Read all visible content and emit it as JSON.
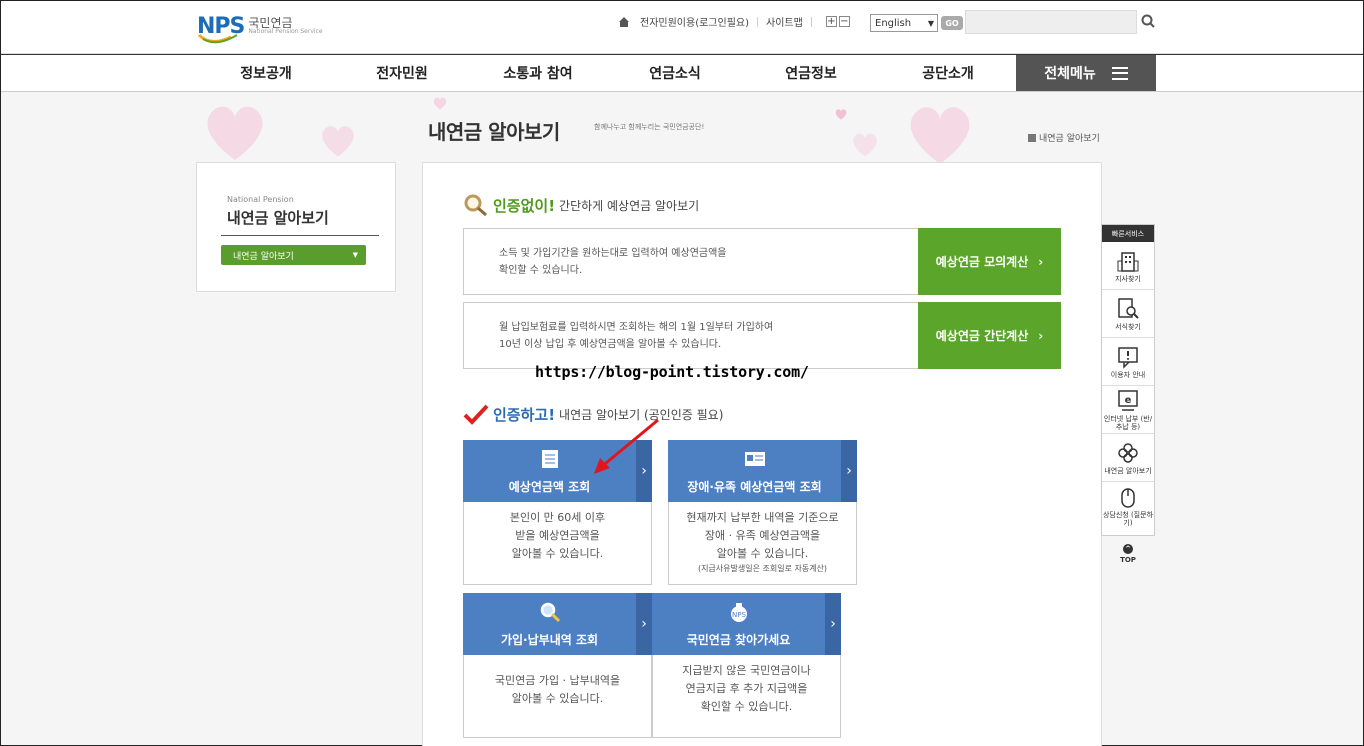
{
  "header": {
    "logo_text": "NPS",
    "logo_kr": "국민연금",
    "logo_en": "National Pension Service",
    "util_links": [
      "전자민원이용(로그인필요)",
      "사이트맵"
    ],
    "zoom_in": "+",
    "zoom_out": "−",
    "language": "English",
    "go_label": "GO",
    "search_placeholder": ""
  },
  "gnb": {
    "items": [
      "정보공개",
      "전자민원",
      "소통과 참여",
      "연금소식",
      "연금정보",
      "공단소개"
    ],
    "all_menu": "전체메뉴"
  },
  "page": {
    "title": "내연금 알아보기",
    "subtitle": "함께나누고 함께누리는 국민연금공단!",
    "breadcrumb": "내연금 알아보기"
  },
  "lnb": {
    "en": "National Pension",
    "title": "내연금 알아보기",
    "button": "내연금 알아보기"
  },
  "section1": {
    "strong": "인증없이!",
    "rest": "간단하게 예상연금 알아보기",
    "boxes": [
      {
        "line1": "소득 및 가입기간을 원하는대로 입력하여 예상연금액을",
        "line2": "확인할 수 있습니다.",
        "button": "예상연금 모의계산"
      },
      {
        "line1": "월 납입보험료를 입력하시면 조회하는 해의 1월 1일부터 가입하여",
        "line2": "10년 이상 납입 후 예상연금액을 알아볼 수 있습니다.",
        "button": "예상연금 간단계산"
      }
    ]
  },
  "watermark": "https://blog-point.tistory.com/",
  "section2": {
    "strong": "인증하고!",
    "rest": "내연금 알아보기 (공인인증 필요)",
    "cards": [
      {
        "title": "예상연금액 조회",
        "l1": "본인이 만 60세 이후",
        "l2": "받을 예상연금액을",
        "l3": "알아볼 수 있습니다.",
        "note": ""
      },
      {
        "title": "장애·유족 예상연금액 조회",
        "l1": "현재까지 납부한 내역을 기준으로",
        "l2": "장애 · 유족 예상연금액을",
        "l3": "알아볼 수 있습니다.",
        "note": "(지급사유발생일은 조회일로 자동계산)"
      },
      {
        "title": "가입·납부내역 조회",
        "l1": "국민연금 가입 · 납부내역을",
        "l2": "알아볼 수 있습니다.",
        "l3": "",
        "note": ""
      },
      {
        "title": "국민연금 찾아가세요",
        "l1": "지급받지 않은 국민연금이나",
        "l2": "연금지급 후 추가 지급액을",
        "l3": "확인할 수 있습니다.",
        "note": ""
      }
    ]
  },
  "quick": {
    "title": "빠른서비스",
    "items": [
      "지사찾기",
      "서식찾기",
      "이용자 안내",
      "인터넷 납부 (반/추납 등)",
      "내연금 알아보기",
      "상담신청 (질문하기)"
    ],
    "top": "TOP"
  },
  "colors": {
    "green": "#5aa52a",
    "blue": "#4d7fc3",
    "dark": "#545454"
  }
}
